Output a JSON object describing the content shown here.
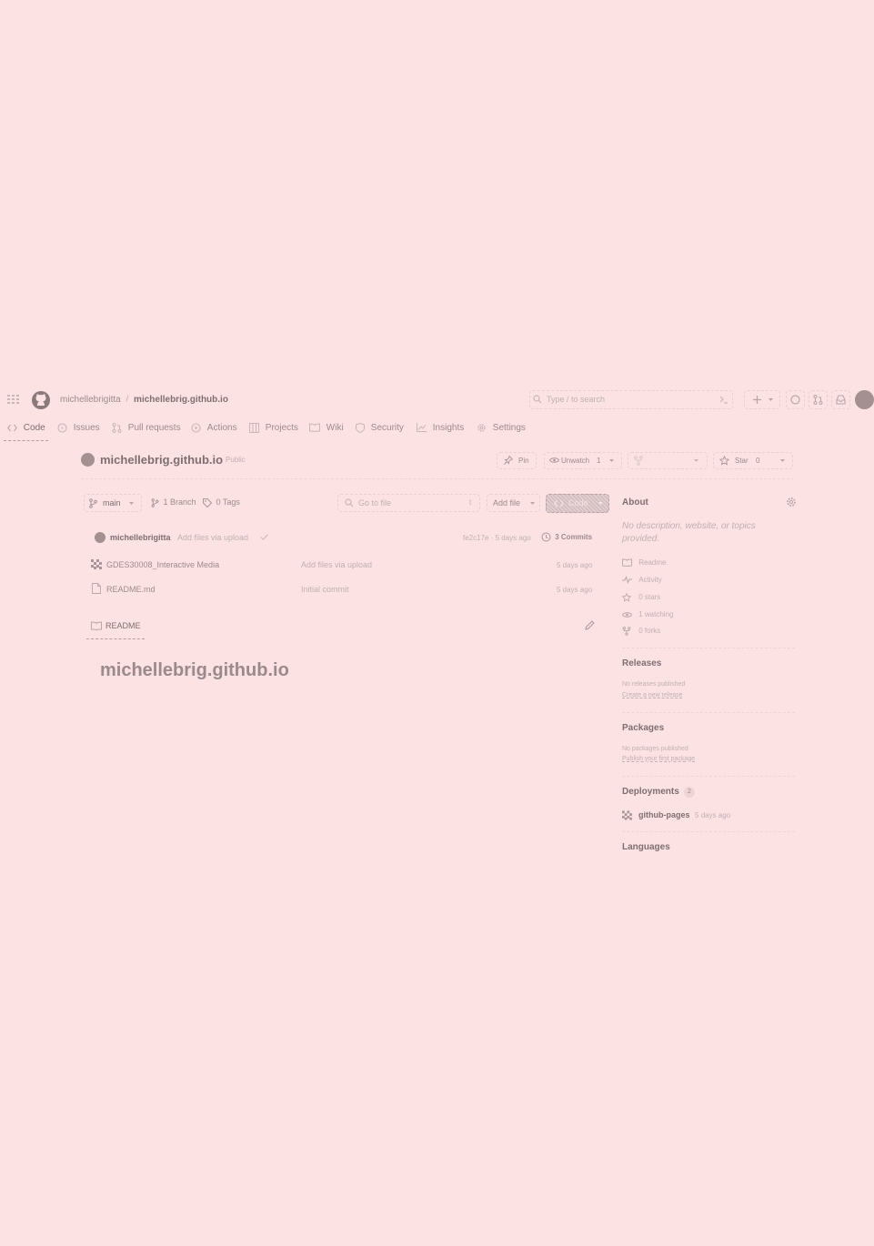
{
  "header": {
    "owner": "michellebrigitta",
    "separator": "/",
    "repo": "michellebrig.github.io",
    "search_placeholder": "Type / to search"
  },
  "tabs": [
    {
      "label": "Code",
      "icon": "code-icon",
      "active": true
    },
    {
      "label": "Issues",
      "icon": "issue-icon"
    },
    {
      "label": "Pull requests",
      "icon": "pull-request-icon"
    },
    {
      "label": "Actions",
      "icon": "play-icon"
    },
    {
      "label": "Projects",
      "icon": "table-icon"
    },
    {
      "label": "Wiki",
      "icon": "book-icon"
    },
    {
      "label": "Security",
      "icon": "shield-icon"
    },
    {
      "label": "Insights",
      "icon": "graph-icon"
    },
    {
      "label": "Settings",
      "icon": "gear-icon"
    }
  ],
  "repo_header": {
    "name": "michellebrig.github.io",
    "visibility": "Public",
    "pin_label": "Pin",
    "unwatch_label": "Unwatch",
    "watch_count": "1",
    "star_label": "Star",
    "star_count": "0"
  },
  "toolbar": {
    "branch": "main",
    "branches": "1 Branch",
    "tags": "0 Tags",
    "go_to_file": "Go to file",
    "go_to_file_key": "t",
    "add_file": "Add file",
    "code_button": "Code"
  },
  "latest_commit": {
    "author": "michellebrigitta",
    "message": "Add files via upload",
    "hash_time": "fe2c17e · 5 days ago",
    "commits": "3 Commits"
  },
  "files": [
    {
      "name": "GDES30008_Interactive Media",
      "icon": "folder-icon",
      "message": "Add files via upload",
      "time": "5 days ago"
    },
    {
      "name": "README.md",
      "icon": "file-icon",
      "message": "Initial commit",
      "time": "5 days ago"
    }
  ],
  "readme": {
    "tab": "README",
    "heading": "michellebrig.github.io"
  },
  "about": {
    "title": "About",
    "description": "No description, website, or topics provided.",
    "items": [
      {
        "label": "Readme",
        "icon": "book-icon"
      },
      {
        "label": "Activity",
        "icon": "pulse-icon"
      },
      {
        "label": "0 stars",
        "icon": "star-icon"
      },
      {
        "label": "1 watching",
        "icon": "eye-icon"
      },
      {
        "label": "0 forks",
        "icon": "fork-icon"
      }
    ]
  },
  "releases": {
    "title": "Releases",
    "empty": "No releases published",
    "link": "Create a new release"
  },
  "packages": {
    "title": "Packages",
    "empty": "No packages published",
    "link": "Publish your first package"
  },
  "deployments": {
    "title": "Deployments",
    "count": "2",
    "env": "github-pages",
    "time": "5 days ago"
  },
  "languages": {
    "title": "Languages"
  }
}
